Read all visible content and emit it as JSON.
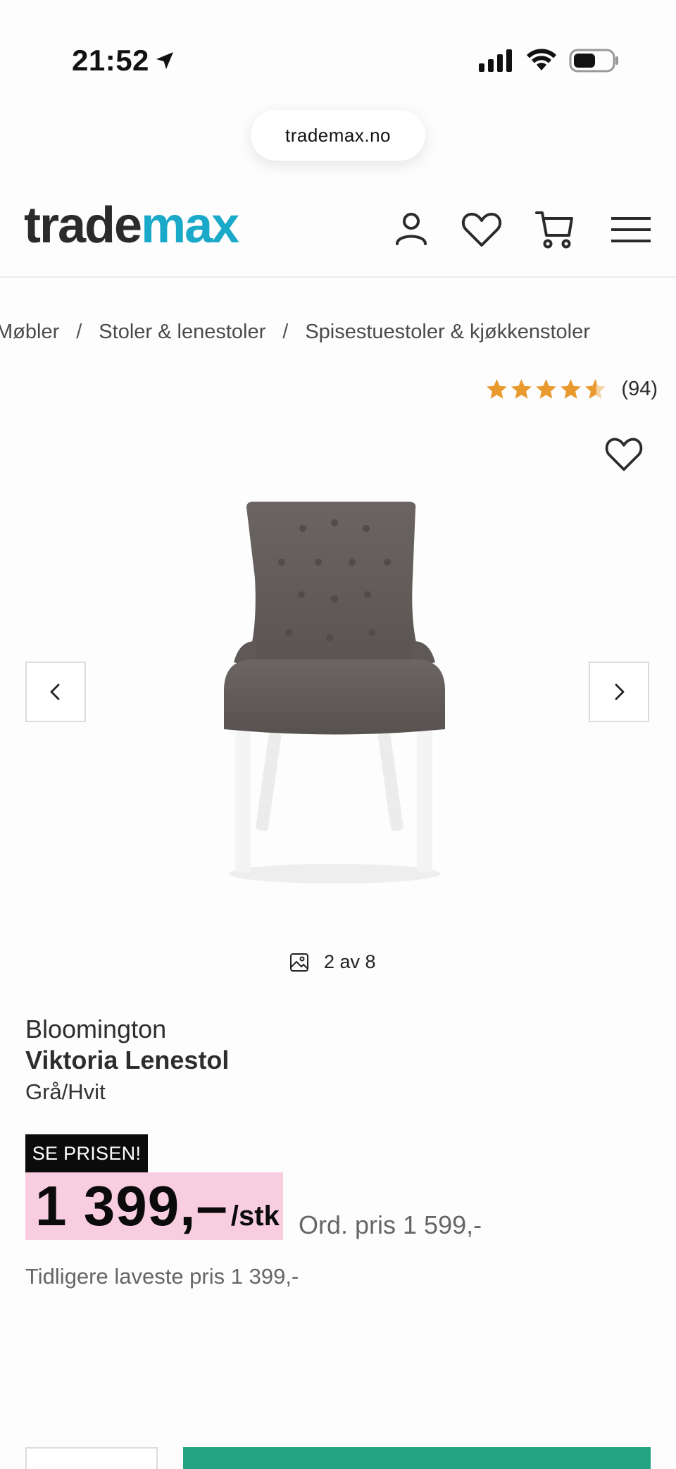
{
  "status_bar": {
    "time": "21:52"
  },
  "browser": {
    "url": "trademax.no"
  },
  "header": {
    "logo_part1": "trade",
    "logo_part2": "max"
  },
  "breadcrumb": [
    "Møbler",
    "Stoler & lenestoler",
    "Spisestuestoler & kjøkkenstoler"
  ],
  "breadcrumb_sep": "/",
  "rating": {
    "stars": 4.5,
    "count": "(94)"
  },
  "gallery": {
    "counter": "2 av 8"
  },
  "product": {
    "brand": "Bloomington",
    "name": "Viktoria Lenestol",
    "variant": "Grå/Hvit"
  },
  "pricing": {
    "badge": "SE PRISEN!",
    "price": "1 399,–",
    "unit": "/stk",
    "ordinary": "Ord. pris 1 599,-",
    "previous_lowest": "Tidligere laveste pris 1 399,-"
  },
  "colors": {
    "accent": "#1ba9c9",
    "star": "#e89a2e",
    "price_bg": "#f8cde0",
    "buy": "#23a381"
  }
}
